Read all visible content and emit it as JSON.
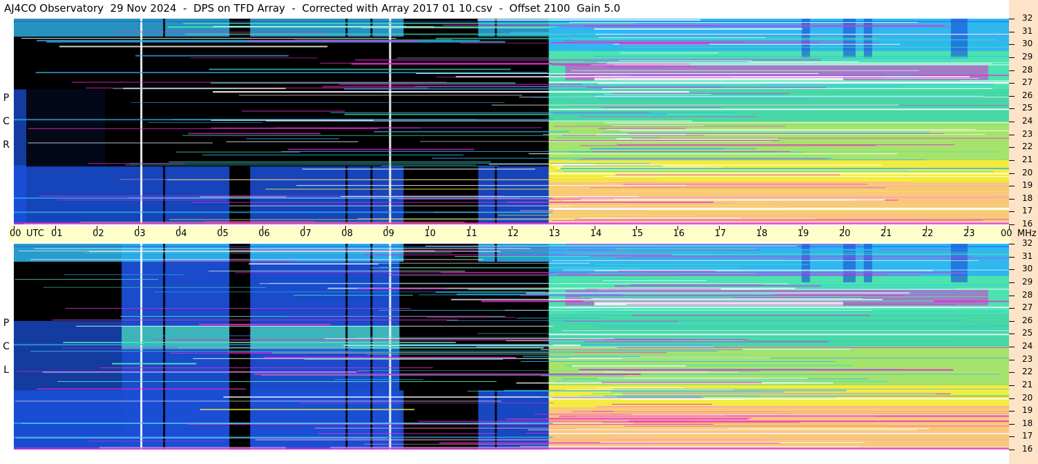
{
  "title": "AJ4CO Observatory  29 Nov 2024  -  DPS on TFD Array  -  Corrected with Array 2017 01 10.csv  -  Offset 2100  Gain 5.0",
  "chart_data": {
    "type": "heatmap",
    "panels": [
      {
        "name_letters": [
          "R",
          "C",
          "P"
        ]
      },
      {
        "name_letters": [
          "L",
          "C",
          "P"
        ]
      }
    ],
    "x_ticks": [
      "00",
      "UTC",
      "01",
      "02",
      "03",
      "04",
      "05",
      "06",
      "07",
      "08",
      "09",
      "10",
      "11",
      "12",
      "13",
      "14",
      "15",
      "16",
      "17",
      "18",
      "19",
      "20",
      "21",
      "22",
      "23",
      "00",
      "MHz"
    ],
    "x_hours": [
      0,
      1,
      2,
      3,
      4,
      5,
      6,
      7,
      8,
      9,
      10,
      11,
      12,
      13,
      14,
      15,
      16,
      17,
      18,
      19,
      20,
      21,
      22,
      23,
      24
    ],
    "y_ticks": [
      "32",
      "31",
      "30",
      "29",
      "28",
      "27",
      "26",
      "25",
      "24",
      "23",
      "22",
      "21",
      "20",
      "19",
      "18",
      "17",
      "16"
    ],
    "ylim": [
      16,
      32
    ],
    "xlim": [
      0,
      24
    ],
    "colors": {
      "black": "#000000",
      "blue": "#1a4fd6",
      "cyan": "#2fb7f0",
      "green": "#4be3b0",
      "yellow": "#f3ec3e",
      "pink": "#ff9fc0",
      "magenta": "#e52cd3",
      "white": "#ffffff"
    }
  }
}
